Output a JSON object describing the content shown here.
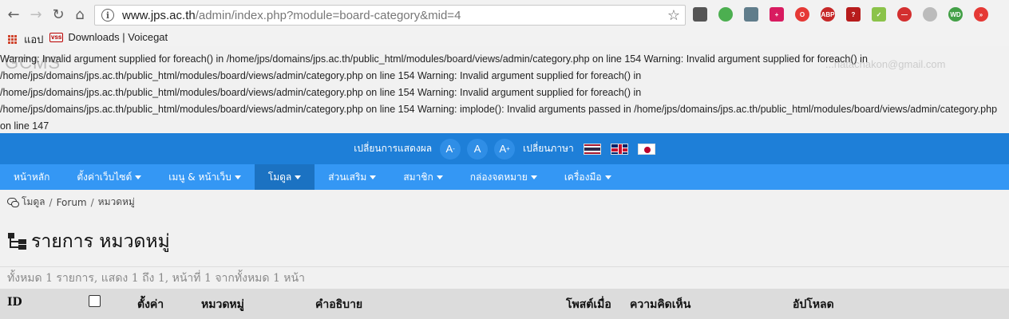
{
  "browser": {
    "url_host": "www.jps.ac.th",
    "url_path": "/admin/index.php?module=board-category&mid=4",
    "bookmarks": [
      {
        "label": "แอป"
      },
      {
        "label": "Downloads | Voicegat"
      }
    ]
  },
  "warning_text": "Warning: Invalid argument supplied for foreach() in /home/jps/domains/jps.ac.th/public_html/modules/board/views/admin/category.php on line 154 Warning: Invalid argument supplied for foreach() in\n/home/jps/domains/jps.ac.th/public_html/modules/board/views/admin/category.php on line 154 Warning: Invalid argument supplied for foreach() in\n/home/jps/domains/jps.ac.th/public_html/modules/board/views/admin/category.php on line 154 Warning: Invalid argument supplied for foreach() in\n/home/jps/domains/jps.ac.th/public_html/modules/board/views/admin/category.php on line 154 Warning: implode(): Invalid arguments passed in /home/jps/domains/jps.ac.th/public_html/modules/board/views/admin/category.php\non line 147",
  "header": {
    "logo": "GCMS",
    "user": "...hatachakon@gmail.com"
  },
  "display_bar": {
    "display_label": "เปลี่ยนการแสดงผล",
    "font_smaller": "A",
    "font_normal": "A",
    "font_larger": "A",
    "language_label": "เปลี่ยนภาษา"
  },
  "menu": [
    {
      "label": "หน้าหลัก",
      "dropdown": false,
      "active": false
    },
    {
      "label": "ตั้งค่าเว็บไซต์",
      "dropdown": true,
      "active": false
    },
    {
      "label": "เมนู & หน้าเว็บ",
      "dropdown": true,
      "active": false
    },
    {
      "label": "โมดูล",
      "dropdown": true,
      "active": true
    },
    {
      "label": "ส่วนเสริม",
      "dropdown": true,
      "active": false
    },
    {
      "label": "สมาชิก",
      "dropdown": true,
      "active": false
    },
    {
      "label": "กล่องจดหมาย",
      "dropdown": true,
      "active": false
    },
    {
      "label": "เครื่องมือ",
      "dropdown": true,
      "active": false
    }
  ],
  "breadcrumb": [
    "โมดูล",
    "Forum",
    "หมวดหมู่"
  ],
  "page_title": "รายการ หมวดหมู่",
  "summary": "ทั้งหมด 1 รายการ, แสดง 1 ถึง 1, หน้าที่ 1 จากทั้งหมด 1 หน้า",
  "table": {
    "columns": [
      "ID",
      "ตั้งค่า",
      "หมวดหมู่",
      "คำอธิบาย",
      "โพสต์เมื่อ",
      "ความคิดเห็น",
      "อัปโหลด"
    ]
  }
}
